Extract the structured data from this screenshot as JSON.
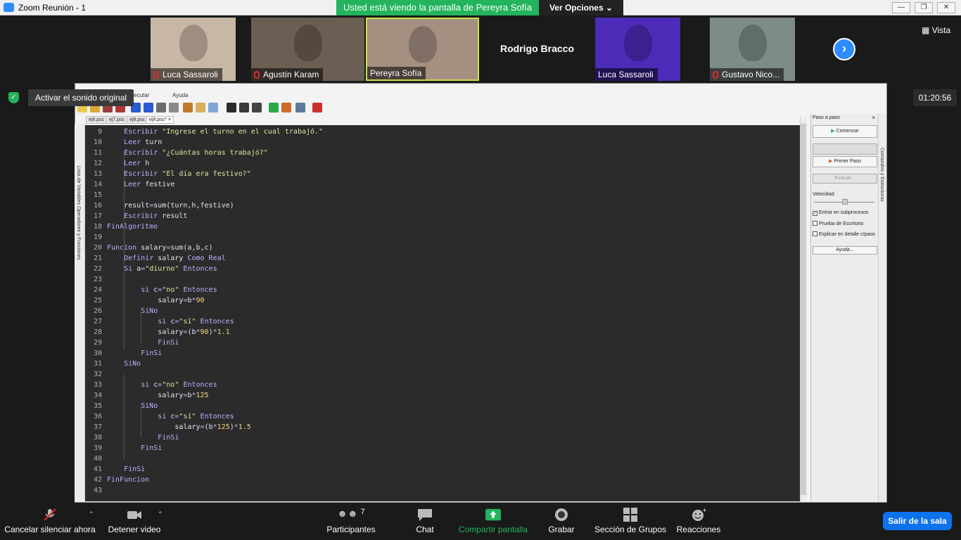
{
  "window": {
    "title": "Zoom Reunión - 1",
    "min_icon": "minimize-icon",
    "max_icon": "restore-icon",
    "close_icon": "close-icon"
  },
  "share_banner": {
    "text": "Usted está viendo la pantalla de Pereyra Sofía"
  },
  "view_options": {
    "label": "Ver Opciones"
  },
  "gallery": {
    "view_label": "Vista",
    "participants": [
      {
        "name": "Luca Sassaroli",
        "muted": true,
        "video": true,
        "color": "#c9b7a6"
      },
      {
        "name": "Agustín Karam",
        "muted": true,
        "video": true,
        "color": "#6b5e52"
      },
      {
        "name": "Pereyra Sofía",
        "muted": false,
        "video": true,
        "active": true,
        "color": "#a48f80"
      },
      {
        "name": "Rodrigo Bracco",
        "muted": false,
        "video": false
      },
      {
        "name": "Luca Sassaroli",
        "muted": false,
        "video": true,
        "color": "#4b2bb8"
      },
      {
        "name": "Gustavo Nico...",
        "muted": true,
        "video": true,
        "color": "#7d8c86"
      }
    ]
  },
  "meeting": {
    "activate_sound": "Activar el sonido original",
    "timer": "01:20:56"
  },
  "pseint": {
    "menu": [
      "Ejecutar",
      "Ayuda"
    ],
    "files": [
      "ej6.psc",
      "ej7.psc",
      "ej8.psc",
      "ej9.psc*"
    ],
    "left_strip": "Lista de Variables  Operadores y Funciones",
    "right_strip": "Comandos y Estructuras",
    "panel": {
      "title": "Paso a paso",
      "start": "Comenzar",
      "first_step": "Primer Paso",
      "evaluate": "Evaluar...",
      "speed": "Velocidad:",
      "checks": [
        {
          "label": "Entrar en subprocesos",
          "checked": true
        },
        {
          "label": "Prueba de Escritorio",
          "checked": false
        },
        {
          "label": "Explicar en detalle c/paso",
          "checked": false
        }
      ],
      "help": "Ayuda..."
    },
    "code": [
      {
        "n": "9",
        "indent": 1,
        "parts": [
          [
            "kw",
            "Escribir"
          ],
          [
            "t",
            " "
          ],
          [
            "str",
            "\"Ingrese el turno en el cual trabajó.\""
          ]
        ]
      },
      {
        "n": "10",
        "indent": 1,
        "parts": [
          [
            "kw",
            "Leer"
          ],
          [
            "t",
            " turn"
          ]
        ]
      },
      {
        "n": "11",
        "indent": 1,
        "parts": [
          [
            "kw",
            "Escribir"
          ],
          [
            "t",
            " "
          ],
          [
            "str",
            "\"¿Cuántas horas trabajó?\""
          ]
        ]
      },
      {
        "n": "12",
        "indent": 1,
        "parts": [
          [
            "kw",
            "Leer"
          ],
          [
            "t",
            " h"
          ]
        ]
      },
      {
        "n": "13",
        "indent": 1,
        "parts": [
          [
            "kw",
            "Escribir"
          ],
          [
            "t",
            " "
          ],
          [
            "str",
            "\"El día era festivo?\""
          ]
        ]
      },
      {
        "n": "14",
        "indent": 1,
        "parts": [
          [
            "kw",
            "Leer"
          ],
          [
            "t",
            " festive"
          ]
        ]
      },
      {
        "n": "15",
        "indent": 0,
        "parts": []
      },
      {
        "n": "16",
        "indent": 1,
        "parts": [
          [
            "t",
            "result"
          ],
          [
            "kw",
            "="
          ],
          [
            "t",
            "sum(turn,h,festive)"
          ]
        ]
      },
      {
        "n": "17",
        "indent": 1,
        "parts": [
          [
            "kw",
            "Escribir"
          ],
          [
            "t",
            " result"
          ]
        ]
      },
      {
        "n": "18",
        "indent": 0,
        "parts": [
          [
            "kw",
            "FinAlgoritmo"
          ]
        ]
      },
      {
        "n": "19",
        "indent": 0,
        "parts": []
      },
      {
        "n": "20",
        "indent": 0,
        "parts": [
          [
            "kw",
            "Funcion"
          ],
          [
            "t",
            " salary"
          ],
          [
            "kw",
            "="
          ],
          [
            "t",
            "sum(a,b,c)"
          ]
        ]
      },
      {
        "n": "21",
        "indent": 1,
        "parts": [
          [
            "kw",
            "Definir"
          ],
          [
            "t",
            " salary "
          ],
          [
            "kw",
            "Como Real"
          ]
        ]
      },
      {
        "n": "22",
        "indent": 1,
        "parts": [
          [
            "kw",
            "Si"
          ],
          [
            "t",
            " a"
          ],
          [
            "kw",
            "="
          ],
          [
            "str",
            "\"diurno\""
          ],
          [
            "t",
            " "
          ],
          [
            "kw",
            "Entonces"
          ]
        ]
      },
      {
        "n": "23",
        "indent": 0,
        "parts": []
      },
      {
        "n": "24",
        "indent": 2,
        "parts": [
          [
            "kw",
            "si"
          ],
          [
            "t",
            " c"
          ],
          [
            "kw",
            "="
          ],
          [
            "str",
            "\"no\""
          ],
          [
            "t",
            " "
          ],
          [
            "kw",
            "Entonces"
          ]
        ]
      },
      {
        "n": "25",
        "indent": 3,
        "parts": [
          [
            "t",
            "salary"
          ],
          [
            "kw",
            "="
          ],
          [
            "t",
            "b"
          ],
          [
            "kw",
            "*"
          ],
          [
            "num",
            "90"
          ]
        ]
      },
      {
        "n": "26",
        "indent": 2,
        "parts": [
          [
            "kw",
            "SiNo"
          ]
        ]
      },
      {
        "n": "27",
        "indent": 3,
        "parts": [
          [
            "kw",
            "si"
          ],
          [
            "t",
            " c"
          ],
          [
            "kw",
            "="
          ],
          [
            "str",
            "\"sí\""
          ],
          [
            "t",
            " "
          ],
          [
            "kw",
            "Entonces"
          ]
        ]
      },
      {
        "n": "28",
        "indent": 3,
        "parts": [
          [
            "t",
            "salary"
          ],
          [
            "kw",
            "="
          ],
          [
            "t",
            "(b"
          ],
          [
            "kw",
            "*"
          ],
          [
            "num",
            "90"
          ],
          [
            "t",
            ")"
          ],
          [
            "kw",
            "*"
          ],
          [
            "num",
            "1.1"
          ]
        ]
      },
      {
        "n": "29",
        "indent": 3,
        "parts": [
          [
            "kw",
            "FinSi"
          ]
        ]
      },
      {
        "n": "30",
        "indent": 2,
        "parts": [
          [
            "kw",
            "FinSi"
          ]
        ]
      },
      {
        "n": "31",
        "indent": 1,
        "parts": [
          [
            "kw",
            "SiNo"
          ]
        ]
      },
      {
        "n": "32",
        "indent": 0,
        "parts": []
      },
      {
        "n": "33",
        "indent": 2,
        "parts": [
          [
            "kw",
            "si"
          ],
          [
            "t",
            " c"
          ],
          [
            "kw",
            "="
          ],
          [
            "str",
            "\"no\""
          ],
          [
            "t",
            " "
          ],
          [
            "kw",
            "Entonces"
          ]
        ]
      },
      {
        "n": "34",
        "indent": 3,
        "parts": [
          [
            "t",
            "salary"
          ],
          [
            "kw",
            "="
          ],
          [
            "t",
            "b"
          ],
          [
            "kw",
            "*"
          ],
          [
            "num",
            "125"
          ]
        ]
      },
      {
        "n": "35",
        "indent": 2,
        "parts": [
          [
            "kw",
            "SiNo"
          ]
        ]
      },
      {
        "n": "36",
        "indent": 3,
        "parts": [
          [
            "kw",
            "si"
          ],
          [
            "t",
            " c"
          ],
          [
            "kw",
            "="
          ],
          [
            "str",
            "\"sí\""
          ],
          [
            "t",
            " "
          ],
          [
            "kw",
            "Entonces"
          ]
        ]
      },
      {
        "n": "37",
        "indent": 4,
        "parts": [
          [
            "t",
            "salary"
          ],
          [
            "kw",
            "="
          ],
          [
            "t",
            "(b"
          ],
          [
            "kw",
            "*"
          ],
          [
            "num",
            "125"
          ],
          [
            "t",
            ")"
          ],
          [
            "kw",
            "*"
          ],
          [
            "num",
            "1.5"
          ]
        ]
      },
      {
        "n": "38",
        "indent": 3,
        "parts": [
          [
            "kw",
            "FinSi"
          ]
        ]
      },
      {
        "n": "39",
        "indent": 2,
        "parts": [
          [
            "kw",
            "FinSi"
          ]
        ]
      },
      {
        "n": "40",
        "indent": 0,
        "parts": []
      },
      {
        "n": "41",
        "indent": 1,
        "parts": [
          [
            "kw",
            "FinSi"
          ]
        ]
      },
      {
        "n": "42",
        "indent": 0,
        "parts": [
          [
            "kw",
            "FinFuncion"
          ]
        ]
      },
      {
        "n": "43",
        "indent": 0,
        "parts": []
      }
    ]
  },
  "bottom_bar": {
    "items": [
      {
        "key": "mute",
        "label": "Cancelar silenciar ahora",
        "icon": "muted-mic-icon"
      },
      {
        "key": "video",
        "label": "Detener video",
        "icon": "video-camera-icon"
      },
      {
        "key": "participants",
        "label": "Participantes",
        "count": "7",
        "icon": "participants-icon"
      },
      {
        "key": "chat",
        "label": "Chat",
        "icon": "chat-icon"
      },
      {
        "key": "share",
        "label": "Compartir pantalla",
        "icon": "share-screen-icon"
      },
      {
        "key": "record",
        "label": "Grabar",
        "icon": "record-icon"
      },
      {
        "key": "rooms",
        "label": "Sección de Grupos",
        "icon": "breakout-rooms-icon"
      },
      {
        "key": "reactions",
        "label": "Reacciones",
        "icon": "reactions-icon"
      }
    ],
    "leave": "Salir de la sala"
  },
  "colors": {
    "zoom_blue": "#2d8cff",
    "share_green": "#23b45d",
    "leave_blue": "#0e72ed",
    "editor_bg": "#2b2b2b"
  }
}
